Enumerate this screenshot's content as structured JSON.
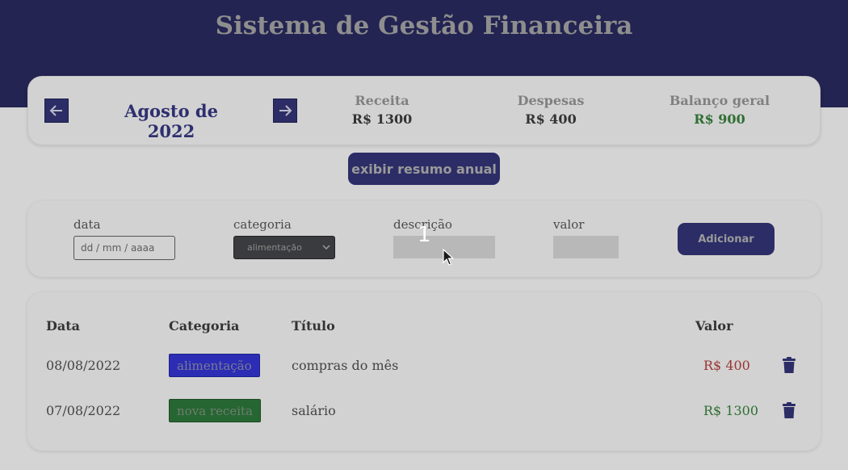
{
  "app": {
    "title": "Sistema de Gestão Financeira"
  },
  "period": {
    "label": "Agosto de 2022"
  },
  "metrics": {
    "income_label": "Receita",
    "income_value": "R$ 1300",
    "expense_label": "Despesas",
    "expense_value": "R$ 400",
    "balance_label": "Balanço geral",
    "balance_value": "R$ 900"
  },
  "actions": {
    "annual_summary_label": "exibir resumo anual",
    "add_label": "Adicionar"
  },
  "form": {
    "date_label": "data",
    "date_placeholder": "dd / mm / aaaa",
    "category_label": "categoria",
    "category_selected": "alimentação",
    "description_label": "descrição",
    "description_value": "",
    "amount_label": "valor",
    "amount_value": ""
  },
  "table": {
    "headers": {
      "date": "Data",
      "category": "Categoria",
      "title": "Título",
      "value": "Valor"
    },
    "rows": [
      {
        "date": "08/08/2022",
        "category": "alimentação",
        "title": "compras do mês",
        "value": "R$ 400",
        "type": "expense"
      },
      {
        "date": "07/08/2022",
        "category": "nova receita",
        "title": "salário",
        "value": "R$ 1300",
        "type": "income"
      }
    ]
  },
  "overlay": {
    "step_number": "1"
  },
  "colors": {
    "header": "#232452",
    "primary": "#2c2d66",
    "positive": "#2f6e33",
    "negative": "#9b3434",
    "expense_badge": "#2c2db4",
    "income_badge": "#266632"
  }
}
